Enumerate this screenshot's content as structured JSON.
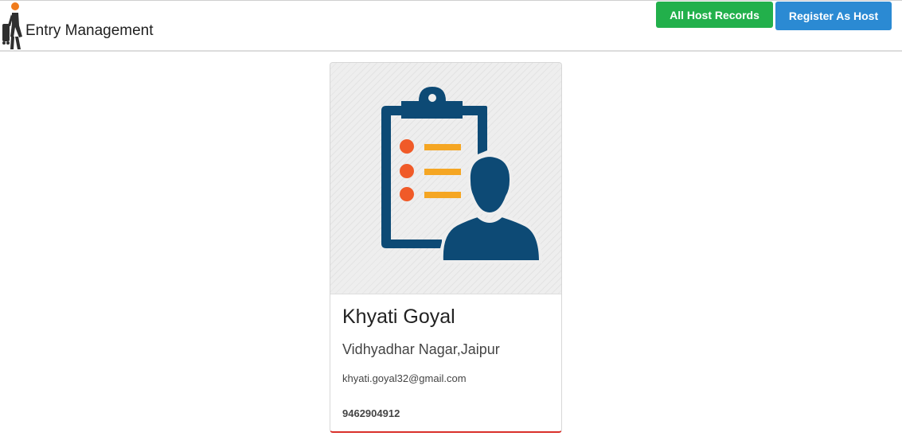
{
  "header": {
    "brand_title": "Entry Management",
    "logo_icon": "walking-person-icon",
    "buttons": {
      "all_host_records": "All Host Records",
      "register_as_host": "Register As Host"
    }
  },
  "host_card": {
    "image_icon": "clipboard-user-icon",
    "name": "Khyati Goyal",
    "address": "Vidhyadhar Nagar,Jaipur",
    "email": "khyati.goyal32@gmail.com",
    "phone": "9462904912"
  },
  "colors": {
    "green_button": "#22b04b",
    "blue_button": "#2b8ad3",
    "icon_navy": "#0d4a75",
    "icon_orange_dot": "#f05a28",
    "icon_yellow_bar": "#f5a623",
    "card_bottom_accent": "#d9302a"
  }
}
